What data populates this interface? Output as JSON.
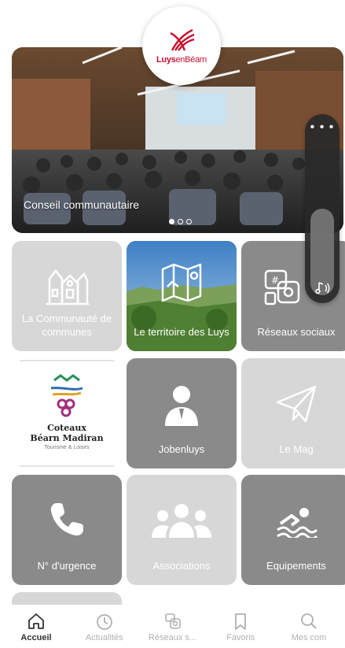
{
  "logo": {
    "brand_bold": "Luys",
    "brand_rest": "enBéarn"
  },
  "hero": {
    "caption": "Conseil communautaire",
    "slide_count": 3,
    "active_slide": 0
  },
  "tiles": {
    "communaute": "La Communauté de communes",
    "territoire": "Le territoire des Luys",
    "reseaux": "Réseaux sociaux",
    "coteaux_title_1": "Coteaux",
    "coteaux_title_2": "Béarn Madiran",
    "coteaux_sub": "Tourisme & Loisirs",
    "jobenluys": "Jobenluys",
    "mag": "Le Mag",
    "urgence": "N° d'urgence",
    "associations": "Associations",
    "equipements": "Equipements"
  },
  "tabbar": {
    "items": [
      {
        "label": "Accueil",
        "icon": "home-icon",
        "active": true
      },
      {
        "label": "Actualités",
        "icon": "news-icon",
        "active": false
      },
      {
        "label": "Réseaux s...",
        "icon": "social-icon",
        "active": false
      },
      {
        "label": "Favoris",
        "icon": "bookmark-icon",
        "active": false
      },
      {
        "label": "Mes com",
        "icon": "search-icon",
        "active": false
      }
    ]
  },
  "colors": {
    "brand_red": "#c8102e",
    "tile_light": "#d7d7d7",
    "tile_dark": "#8a8a8a"
  }
}
